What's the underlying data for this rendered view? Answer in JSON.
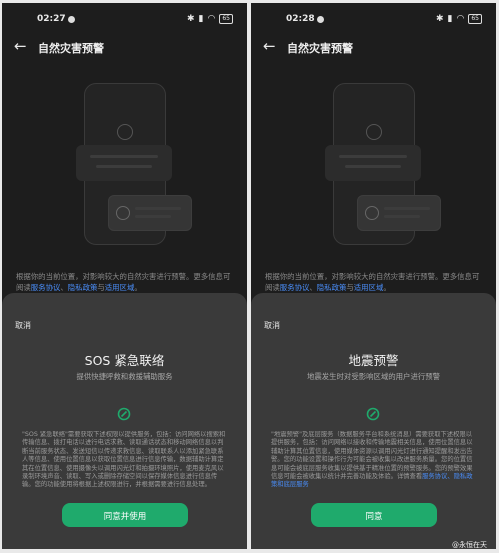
{
  "screens": [
    {
      "status_time": "02:27",
      "battery": "65",
      "back_glyph": "←",
      "page_title": "自然灾害预警",
      "desc_text": "根据你的当前位置，对影响较大的自然灾害进行预警。更多信息可阅读",
      "desc_link1": "服务协议",
      "desc_sep": "、",
      "desc_link2": "隐私政策",
      "desc_and": "与",
      "desc_link3": "适用区域",
      "desc_end": "。",
      "sheet": {
        "cancel_label": "取消",
        "title": "SOS 紧急联络",
        "subtitle": "提供快捷呼救和救援辅助服务",
        "body": "\"SOS 紧急联络\"需要获取下述权限以提供服务，包括：访问网络以搜索和传输信息、拨打电话以进行电话求救、读取通话状态和移动网络信息以判断当前服务状态、发送短信以传递求救信息、读取联系人以添加紧急联系人等信息、使用位置信息以获取位置信息进行信息传输，数据辅助计算定其在位置信息、使用摄像头以调用闪光灯和拍摄环境照片，使用麦克风以录制环境声音、读取、写入或删除存储空间以保存媒体信息进行信息传输。您的功能使用将根据上述权限进行，并根据需要进行信息处理。",
        "agree_label": "同意并使用"
      }
    },
    {
      "status_time": "02:28",
      "battery": "65",
      "back_glyph": "←",
      "page_title": "自然灾害预警",
      "desc_text": "根据你的当前位置，对影响较大的自然灾害进行预警。更多信息可阅读",
      "desc_link1": "服务协议",
      "desc_sep": "、",
      "desc_link2": "隐私政策",
      "desc_and": "与",
      "desc_link3": "适用区域",
      "desc_end": "。",
      "sheet": {
        "cancel_label": "取消",
        "title": "地震预警",
        "subtitle": "地震发生时对受影响区域的用户进行预警",
        "body": "\"地震预警\"及底层服务（数据服务平台和系统消息）需要获取下述权限以提供服务，包括：访问网络以接收和传输地震相关信息，使用位置信息以辅助计算其位置信息，使用媒体资源以调用闪光灯进行通知提醒和发出告警。您的功能设置和操作行为可能会被收集以改进服务质量。您的位置信息可能会被底层服务收集以提供基于精准位置的预警服务。您的预警效果信息可能会被收集以统计并完善功能及体验。详情查看",
        "body_link": "服务协议、隐私政策和底层服务",
        "agree_label": "同意"
      }
    }
  ],
  "watermark": "@永恒在天"
}
